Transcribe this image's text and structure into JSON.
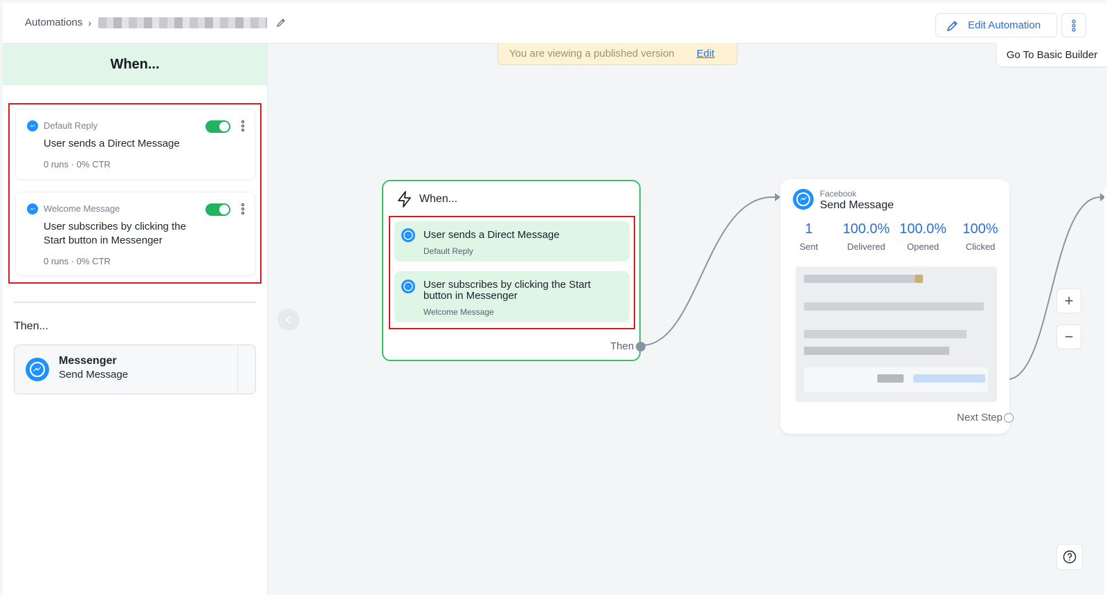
{
  "header": {
    "breadcrumb_root": "Automations",
    "edit_automation_label": "Edit Automation"
  },
  "left_panel": {
    "when_title": "When...",
    "triggers": [
      {
        "type": "Default Reply",
        "title": "User sends a Direct Message",
        "stats": "0 runs · 0% CTR",
        "enabled": true
      },
      {
        "type": "Welcome Message",
        "title": "User subscribes by clicking the Start button in Messenger",
        "stats": "0 runs · 0% CTR",
        "enabled": true
      }
    ],
    "then_title": "Then...",
    "then_action": {
      "channel": "Messenger",
      "action": "Send Message"
    }
  },
  "canvas": {
    "banner_text": "You are viewing a published version",
    "banner_link": "Edit",
    "basic_builder_label": "Go To Basic Builder",
    "when_node": {
      "title": "When...",
      "items": [
        {
          "title": "User sends a Direct Message",
          "subtitle": "Default Reply"
        },
        {
          "title": "User subscribes by clicking the Start button in Messenger",
          "subtitle": "Welcome Message"
        }
      ],
      "then_label": "Then"
    },
    "send_node": {
      "source": "Facebook",
      "name": "Send Message",
      "metrics": [
        {
          "value": "1",
          "label": "Sent"
        },
        {
          "value": "100.0%",
          "label": "Delivered"
        },
        {
          "value": "100.0%",
          "label": "Opened"
        },
        {
          "value": "100%",
          "label": "Clicked"
        }
      ],
      "next_label": "Next Step"
    },
    "zoom_in": "+",
    "zoom_out": "−"
  },
  "colors": {
    "accent": "#2b6fd6",
    "success": "#22b35e",
    "highlight": "#e0171b",
    "trigger_bg": "#e1f6e8"
  }
}
